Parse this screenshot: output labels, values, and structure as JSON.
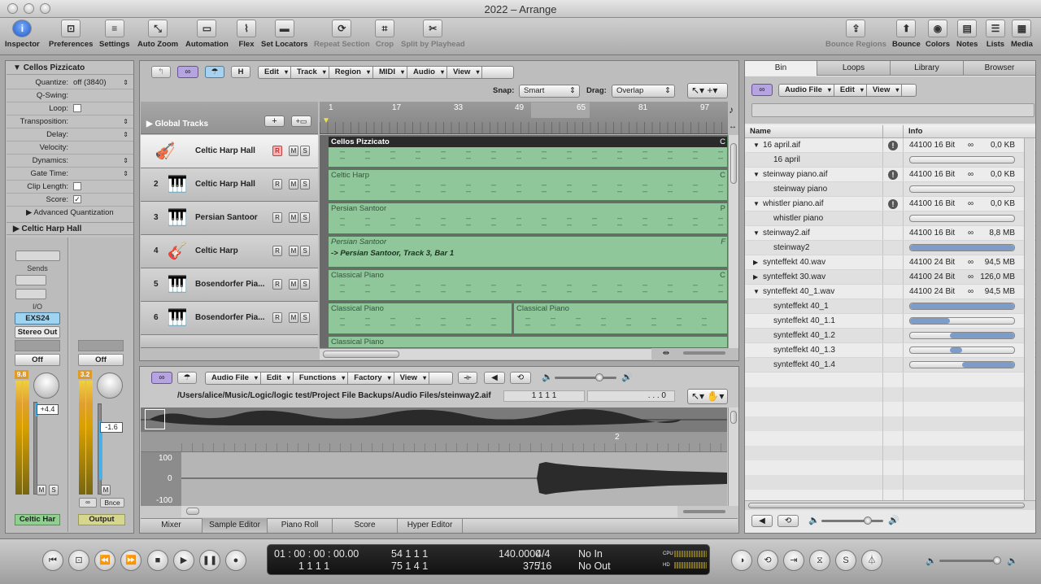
{
  "window": {
    "title": "2022  – Arrange"
  },
  "toolbar": {
    "left": [
      {
        "label": "Inspector",
        "icon": "i"
      },
      {
        "label": "Preferences",
        "icon": "⊡"
      },
      {
        "label": "Settings",
        "icon": "≡"
      },
      {
        "label": "Auto Zoom",
        "icon": "⤡"
      },
      {
        "label": "Automation",
        "icon": "▭"
      },
      {
        "label": "Flex",
        "icon": "⌇"
      },
      {
        "label": "Set Locators",
        "icon": "▬"
      },
      {
        "label": "Repeat Section",
        "icon": "⟳"
      },
      {
        "label": "Crop",
        "icon": "⌗"
      },
      {
        "label": "Split by Playhead",
        "icon": "✂"
      }
    ],
    "right": [
      {
        "label": "Bounce Regions",
        "icon": "⇪"
      },
      {
        "label": "Bounce",
        "icon": "⬆"
      },
      {
        "label": "Colors",
        "icon": "◉"
      },
      {
        "label": "Notes",
        "icon": "▤"
      },
      {
        "label": "Lists",
        "icon": "☰"
      },
      {
        "label": "Media",
        "icon": "▦"
      }
    ]
  },
  "inspector": {
    "region_title": "Cellos Pizzicato",
    "rows": [
      {
        "label": "Quantize:",
        "value": "off (3840)"
      },
      {
        "label": "Q-Swing:",
        "value": ""
      },
      {
        "label": "Loop:",
        "value": ""
      },
      {
        "label": "Transposition:",
        "value": ""
      },
      {
        "label": "Delay:",
        "value": ""
      },
      {
        "label": "Velocity:",
        "value": ""
      },
      {
        "label": "Dynamics:",
        "value": ""
      },
      {
        "label": "Gate Time:",
        "value": ""
      },
      {
        "label": "Clip Length:",
        "value": ""
      },
      {
        "label": "Score:",
        "value": "✓"
      }
    ],
    "advanced": "Advanced Quantization",
    "track_title": "Celtic Harp Hall",
    "sends": "Sends",
    "io": "I/O",
    "instrument": "EXS24",
    "output": "Stereo Out",
    "off1": "Off",
    "off2": "Off",
    "meter1": "9.8",
    "meter2": "3.2",
    "gain1": "+4.4",
    "gain2": "-1.6",
    "m": "M",
    "s": "S",
    "bnce": "Bnce",
    "name1": "Celtic Har",
    "name2": "Output"
  },
  "arrange": {
    "menus": [
      "Edit",
      "Track",
      "Region",
      "MIDI",
      "Audio",
      "View"
    ],
    "h_btn": "H",
    "snap_label": "Snap:",
    "snap_value": "Smart",
    "drag_label": "Drag:",
    "drag_value": "Overlap",
    "global_tracks": "Global Tracks",
    "ruler": [
      "1",
      "17",
      "33",
      "49",
      "65",
      "81",
      "97"
    ],
    "tracks": [
      {
        "num": "",
        "name": "Celtic Harp Hall",
        "icon": "🎻",
        "r": "R"
      },
      {
        "num": "2",
        "name": "Celtic Harp Hall",
        "icon": "🎹",
        "r": "R"
      },
      {
        "num": "3",
        "name": "Persian Santoor",
        "icon": "🎹",
        "r": "R"
      },
      {
        "num": "4",
        "name": "Celtic Harp",
        "icon": "🎸",
        "r": "R"
      },
      {
        "num": "5",
        "name": "Bosendorfer Pia...",
        "icon": "🎹",
        "r": "R"
      },
      {
        "num": "6",
        "name": "Bosendorfer Pia...",
        "icon": "🎹",
        "r": "R"
      }
    ],
    "regions": {
      "r1": "Cellos Pizzicato",
      "r2": "Celtic Harp",
      "r3": "Persian Santoor",
      "r4": "Persian Santoor",
      "r4b": "-> Persian Santoor, Track 3, Bar 1",
      "r5": "Classical Piano",
      "r6a": "Classical Piano",
      "r6b": "Classical Piano",
      "r7": "Classical Piano",
      "c": "C",
      "p": "P",
      "f": "F"
    }
  },
  "sample_editor": {
    "menus": [
      "Audio File",
      "Edit",
      "Functions",
      "Factory",
      "View"
    ],
    "path": "/Users/alice/Music/Logic/logic test/Project File Backups/Audio Files/steinway2.aif",
    "pos": "1  1  1  1",
    "pos2": ". . .  0",
    "marker2": "2",
    "y_top": "100",
    "y_mid": "0",
    "y_bot": "-100",
    "tabs": [
      "Mixer",
      "Sample Editor",
      "Piano Roll",
      "Score",
      "Hyper Editor"
    ]
  },
  "bin": {
    "tabs": [
      "Bin",
      "Loops",
      "Library",
      "Browser"
    ],
    "menus": [
      "Audio File",
      "Edit",
      "View"
    ],
    "col_name": "Name",
    "col_info": "Info",
    "rows": [
      {
        "name": "16 april.aif",
        "info": "44100 16 Bit",
        "size": "0,0 KB",
        "type": "file",
        "open": true,
        "warn": true
      },
      {
        "name": "16 april",
        "type": "sub",
        "bar": [
          0,
          0
        ]
      },
      {
        "name": "steinway piano.aif",
        "info": "44100 16 Bit",
        "size": "0,0 KB",
        "type": "file",
        "open": true,
        "warn": true
      },
      {
        "name": "steinway piano",
        "type": "sub",
        "bar": [
          0,
          0
        ]
      },
      {
        "name": "whistler piano.aif",
        "info": "44100 16 Bit",
        "size": "0,0 KB",
        "type": "file",
        "open": true,
        "warn": true
      },
      {
        "name": "whistler piano",
        "type": "sub",
        "bar": [
          0,
          0
        ]
      },
      {
        "name": "steinway2.aif",
        "info": "44100 16 Bit",
        "size": "8,8 MB",
        "type": "file",
        "open": true
      },
      {
        "name": "steinway2",
        "type": "sub",
        "bar": [
          0,
          100
        ]
      },
      {
        "name": "synteffekt 40.wav",
        "info": "44100 24 Bit",
        "size": "94,5 MB",
        "type": "file",
        "open": false
      },
      {
        "name": "synteffekt 30.wav",
        "info": "44100 24 Bit",
        "size": "126,0 MB",
        "type": "file",
        "open": false
      },
      {
        "name": "synteffekt 40_1.wav",
        "info": "44100 24 Bit",
        "size": "94,5 MB",
        "type": "file",
        "open": true
      },
      {
        "name": "synteffekt 40_1",
        "type": "sub",
        "bar": [
          0,
          100
        ]
      },
      {
        "name": "synteffekt 40_1.1",
        "type": "sub",
        "bar": [
          0,
          38
        ]
      },
      {
        "name": "synteffekt 40_1.2",
        "type": "sub",
        "bar": [
          38,
          100
        ]
      },
      {
        "name": "synteffekt 40_1.3",
        "type": "sub",
        "bar": [
          38,
          50
        ]
      },
      {
        "name": "synteffekt 40_1.4",
        "type": "sub",
        "bar": [
          50,
          100
        ]
      }
    ]
  },
  "transport": {
    "smpte": "01 : 00 : 00 : 00.00",
    "bars": "1     1     1     1",
    "pos_a": "54    1     1      1",
    "pos_b": "75    1     4      1",
    "tempo": "140.0000",
    "tempo2": "375",
    "sig": "4/4",
    "div": "/16",
    "in": "No In",
    "out": "No Out",
    "cpu": "CPU",
    "hd": "HD"
  }
}
